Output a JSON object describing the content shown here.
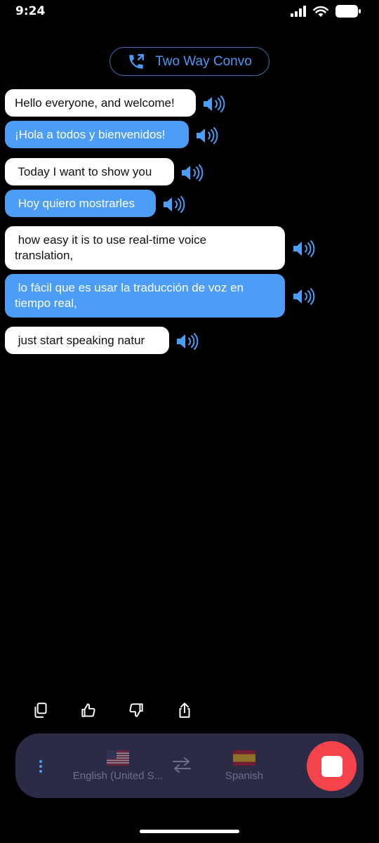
{
  "status_bar": {
    "time": "9:24",
    "icons": [
      "signal-icon",
      "wifi-icon",
      "battery-icon"
    ]
  },
  "header": {
    "mode_label": "Two Way Convo",
    "mode_icon": "phone-call-icon"
  },
  "messages": [
    {
      "role": "source",
      "text": "Hello everyone, and welcome!"
    },
    {
      "role": "translation",
      "text": "¡Hola a todos y bienvenidos!"
    },
    {
      "role": "source",
      "text": " Today I want to show you"
    },
    {
      "role": "translation",
      "text": " Hoy quiero mostrarles"
    },
    {
      "role": "source",
      "line1": " how easy it is to use real-time voice",
      "line2": "translation,"
    },
    {
      "role": "translation",
      "line1": " lo fácil que es usar la traducción de voz en",
      "line2": "tiempo real,"
    },
    {
      "role": "source",
      "text": " just start speaking natur"
    }
  ],
  "actions": [
    "copy-icon",
    "thumbs-up-icon",
    "thumbs-down-icon",
    "share-icon"
  ],
  "bottom_bar": {
    "source_language": "English (United S...",
    "target_language": "Spanish",
    "source_flag": "us-flag-icon",
    "target_flag": "spain-flag-icon",
    "swap_icon": "swap-arrows-icon",
    "menu_icon": "more-vertical-icon",
    "stop_icon": "stop-icon"
  },
  "colors": {
    "accent": "#4b9df6",
    "source_bubble": "#ffffff",
    "translation_bubble": "#4b9df6",
    "stop_button": "#f4434b",
    "bar_background": "#2b2b45"
  }
}
